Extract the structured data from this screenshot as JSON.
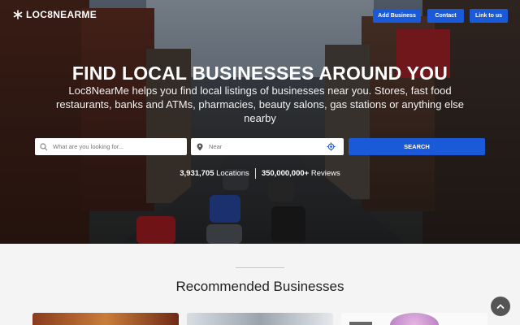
{
  "header": {
    "logo_text": "LOC8NEARME",
    "logo_icon": "asterisk-logo-icon",
    "nav": [
      {
        "label": "Add Business"
      },
      {
        "label": "Contact"
      },
      {
        "label": "Link to us"
      }
    ]
  },
  "hero": {
    "title": "FIND LOCAL BUSINESSES AROUND YOU",
    "subtitle": "Loc8NearMe helps you find local listings of businesses near you. Stores, fast food restaurants, banks and ATMs, pharmacies, beauty salons, gas stations or anything else nearby",
    "search": {
      "what_placeholder": "What are you looking for...",
      "near_placeholder": "Near",
      "button_label": "SEARCH"
    },
    "stats": {
      "locations_count": "3,931,705",
      "locations_label": "Locations",
      "reviews_count": "350,000,000+",
      "reviews_label": "Reviews"
    }
  },
  "recommended": {
    "title": "Recommended Businesses"
  },
  "colors": {
    "accent": "#1a5ad8"
  }
}
